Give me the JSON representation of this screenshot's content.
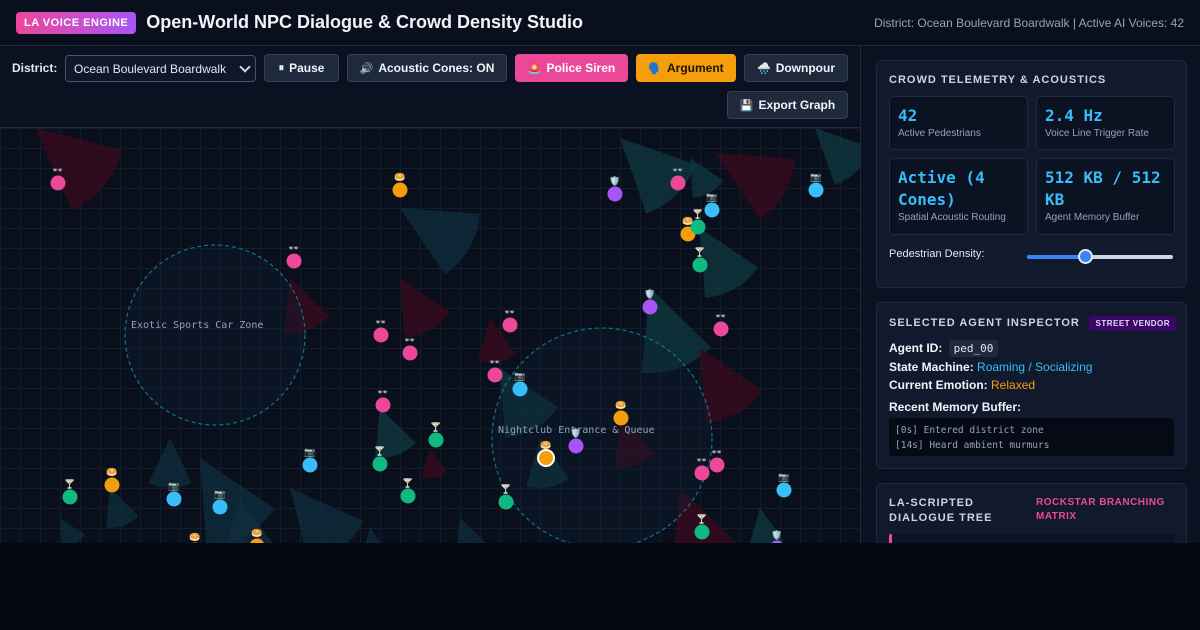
{
  "header": {
    "brand": "LA VOICE ENGINE",
    "title": "Open-World NPC Dialogue & Crowd Density Studio",
    "status": "District: Ocean Boulevard Boardwalk | Active AI Voices: 42"
  },
  "toolbar": {
    "district_label": "District:",
    "district_value": "Ocean Boulevard Boardwalk",
    "buttons": {
      "pause": {
        "glyph": "⏸",
        "label": "Pause"
      },
      "acoustic": {
        "glyph": "🔊",
        "label": "Acoustic Cones: ON"
      },
      "siren": {
        "glyph": "🚨",
        "label": "Police Siren"
      },
      "argument": {
        "glyph": "🗣️",
        "label": "Argument"
      },
      "downpour": {
        "glyph": "🌧️",
        "label": "Downpour"
      },
      "export": {
        "glyph": "💾",
        "label": "Export Graph"
      }
    }
  },
  "map": {
    "zones": [
      {
        "label": "Exotic Sports Car Zone"
      },
      {
        "label": "Nightclub Entrance & Queue"
      }
    ],
    "colors": {
      "pink": "#ec4899",
      "orange": "#f59e0b",
      "purple": "#a855f7",
      "cyan": "#38bdf8",
      "green": "#10b981"
    }
  },
  "telemetry": {
    "title": "CROWD TELEMETRY & ACOUSTICS",
    "cards": [
      {
        "value": "42",
        "label": "Active Pedestrians"
      },
      {
        "value": "2.4 Hz",
        "label": "Voice Line Trigger Rate"
      },
      {
        "value": "Active (4 Cones)",
        "label": "Spatial Acoustic Routing"
      },
      {
        "value": "512 KB / 512 KB",
        "label": "Agent Memory Buffer"
      }
    ],
    "density_label": "Pedestrian Density:",
    "density_level": 0.4
  },
  "inspector": {
    "title": "SELECTED AGENT INSPECTOR",
    "badge": "STREET VENDOR",
    "agent_id_label": "Agent ID:",
    "agent_id": "ped_00",
    "state_label": "State Machine:",
    "state": "Roaming / Socializing",
    "emotion_label": "Current Emotion:",
    "emotion": "Relaxed",
    "memory_label": "Recent Memory Buffer:",
    "memory": [
      "[0s] Entered district zone",
      "[14s] Heard ambient murmurs"
    ]
  },
  "dialogue": {
    "title": "LA-SCRIPTED DIALOGUE TREE",
    "subtitle": "ROCKSTAR BRANCHING MATRIX"
  }
}
